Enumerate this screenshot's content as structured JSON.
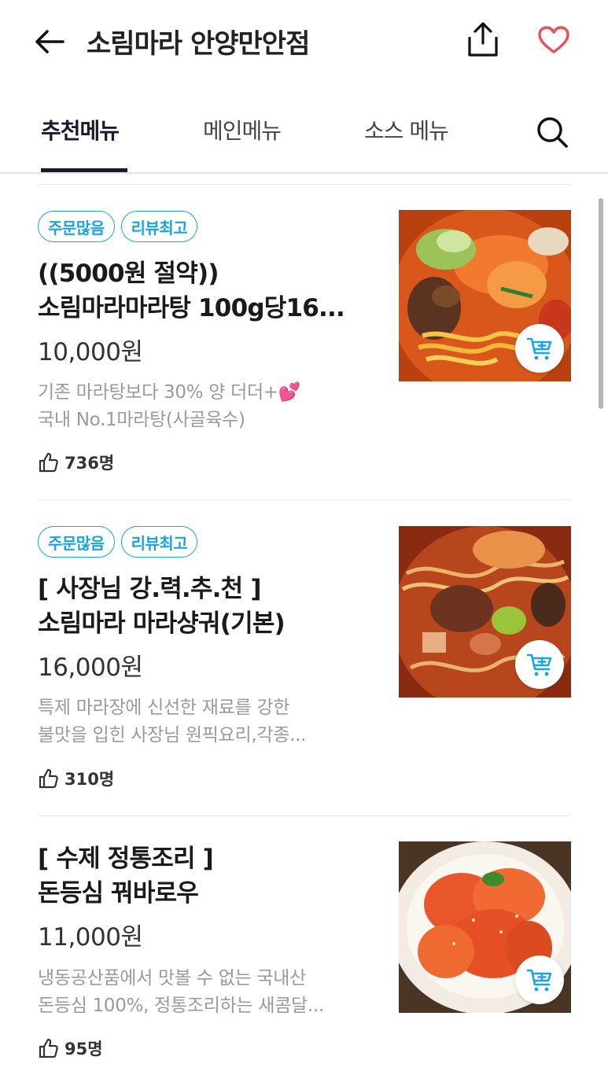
{
  "header": {
    "title": "소림마라 안양만안점",
    "back_icon": "arrow-left-icon",
    "share_icon": "share-icon",
    "heart_icon": "heart-icon",
    "heart_color": "#e8505b"
  },
  "tabs": [
    {
      "label": "추천메뉴",
      "active": true
    },
    {
      "label": "메인메뉴",
      "active": false
    },
    {
      "label": "소스 메뉴",
      "active": false
    }
  ],
  "search_icon": "search-icon",
  "accent_color": "#1ba4e0",
  "menu_items": [
    {
      "badges": [
        "주문많음",
        "리뷰최고"
      ],
      "name_lines": [
        "((5000원 절약))",
        "소림마라마라탕 100g당16..."
      ],
      "price": "10,000원",
      "desc_lines": [
        "기존 마라탕보다 30% 양 더더+💕",
        "국내 No.1마라탕(사골육수)"
      ],
      "likes": "736명"
    },
    {
      "badges": [
        "주문많음",
        "리뷰최고"
      ],
      "name_lines": [
        "[ 사장님 강.력.추.천 ]",
        "소림마라 마라샹궈(기본)"
      ],
      "price": "16,000원",
      "desc_lines": [
        "특제 마라장에 신선한 재료를 강한",
        "불맛을 입힌 사장님 원픽요리,각종..."
      ],
      "likes": "310명"
    },
    {
      "badges": [],
      "name_lines": [
        "[ 수제 정통조리 ]",
        "돈등심 꿔바로우"
      ],
      "price": "11,000원",
      "desc_lines": [
        "냉동공산품에서 맛볼 수 없는 국내산",
        "돈등심 100%, 정통조리하는 새콤달..."
      ],
      "likes": "95명"
    }
  ]
}
